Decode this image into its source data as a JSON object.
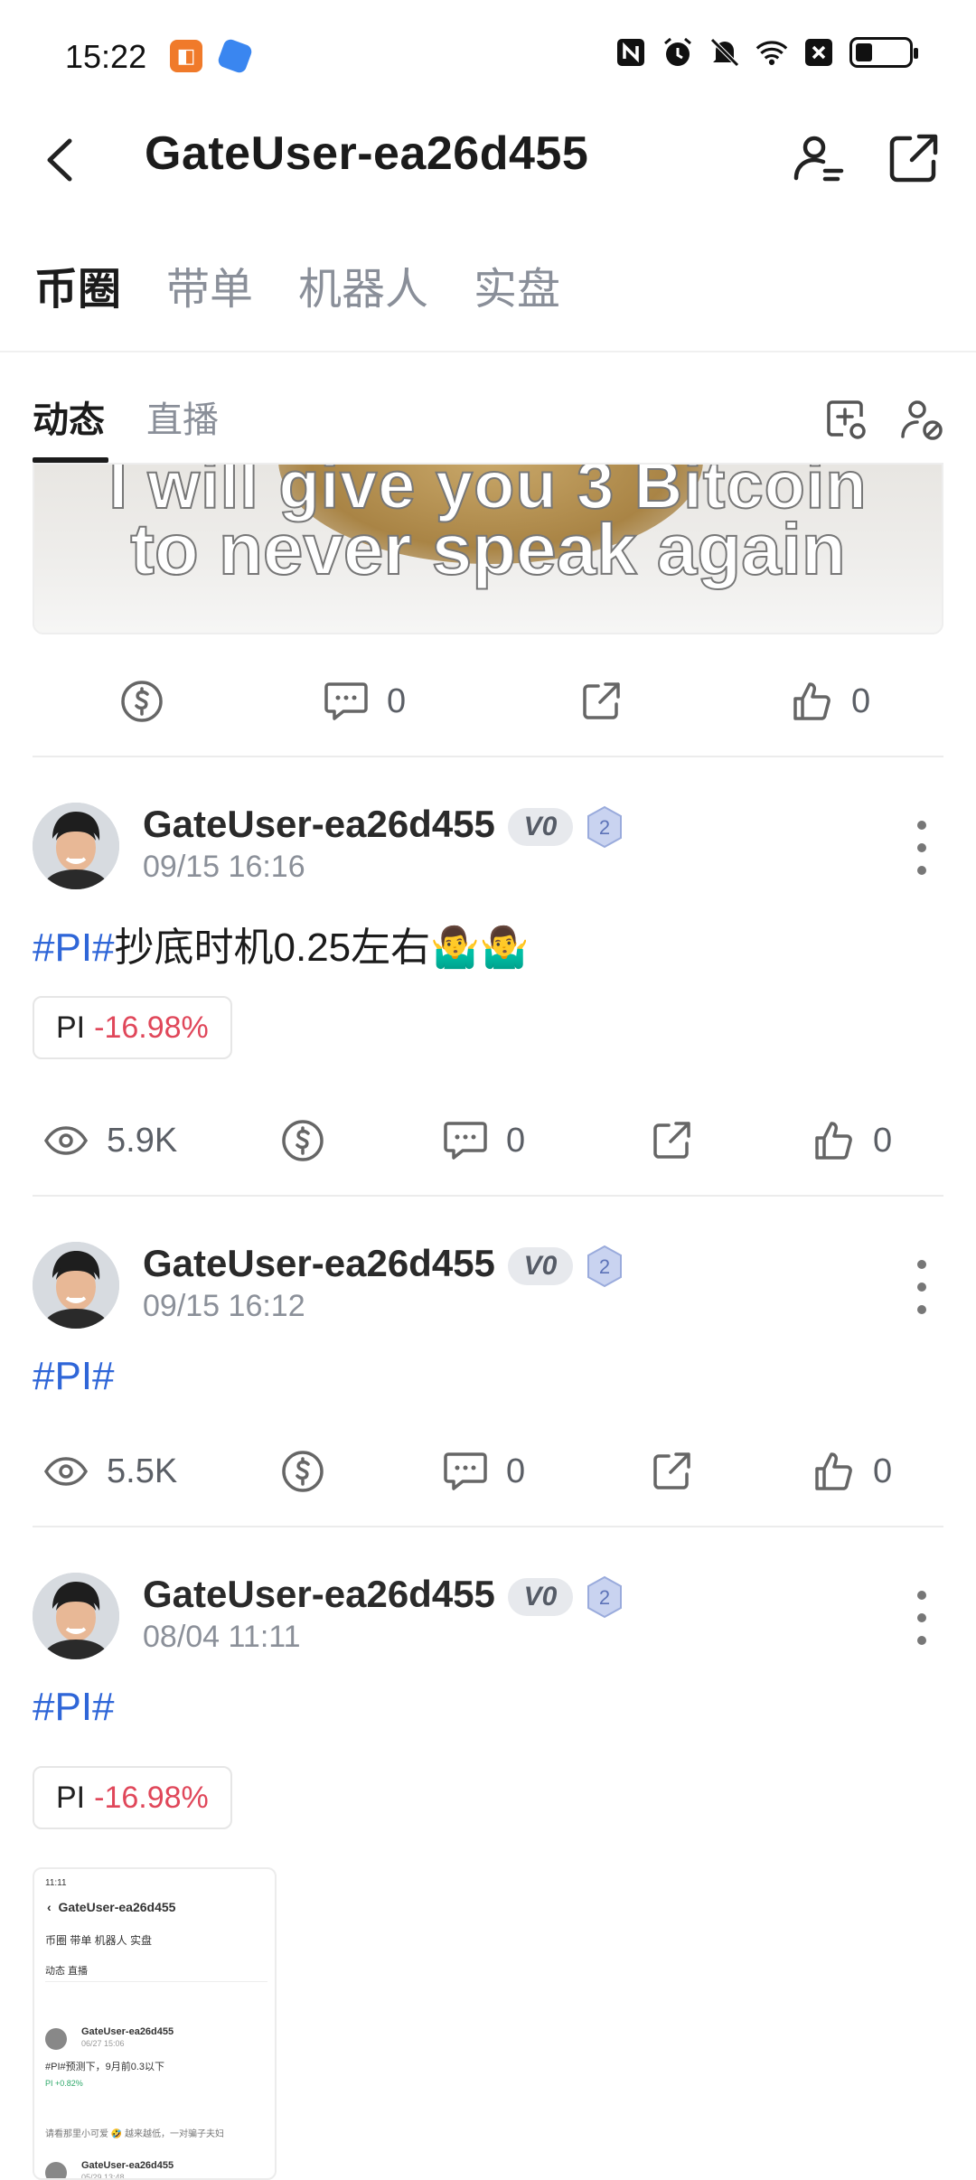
{
  "status_bar": {
    "time": "15:22",
    "icons": [
      "nfc-icon",
      "alarm-icon",
      "mute-icon",
      "wifi-icon",
      "x-notification-icon",
      "battery-icon"
    ]
  },
  "header": {
    "title": "GateUser-ea26d455"
  },
  "main_tabs": [
    "币圈",
    "带单",
    "机器人",
    "实盘"
  ],
  "sub_tabs": [
    "动态",
    "直播"
  ],
  "banner": {
    "line1": "I will give you 3 Bitcoin",
    "line2": "to never speak again"
  },
  "first_actions": {
    "comments": "0",
    "likes": "0"
  },
  "posts": [
    {
      "author": "GateUser-ea26d455",
      "vip": "V0",
      "level": "2",
      "time": "09/15 16:16",
      "hashtag": "#PI#",
      "text": "抄底时机0.25左右🤷‍♂️🤷‍♂️",
      "chip": {
        "coin": "PI",
        "change": "-16.98%"
      },
      "views": "5.9K",
      "comments": "0",
      "likes": "0"
    },
    {
      "author": "GateUser-ea26d455",
      "vip": "V0",
      "level": "2",
      "time": "09/15 16:12",
      "hashtag": "#PI#",
      "text": "",
      "views": "5.5K",
      "comments": "0",
      "likes": "0"
    },
    {
      "author": "GateUser-ea26d455",
      "vip": "V0",
      "level": "2",
      "time": "08/04 11:11",
      "hashtag": "#PI#",
      "text": "",
      "chip": {
        "coin": "PI",
        "change": "-16.98%"
      }
    }
  ],
  "thumbnail": {
    "time": "11:11",
    "title": "GateUser-ea26d455",
    "tabs": "币圈  带单  机器人  实盘",
    "subtabs": "动态  直播",
    "post_author": "GateUser-ea26d455",
    "post_time": "06/27 15:06",
    "post_text": "#PI#预测下，9月前0.3以下",
    "chip": "PI +0.82%",
    "comment_line": "请看那里小可爱 🤣 越来越低，一对骗子夫妇",
    "post2_author": "GateUser-ea26d455",
    "post2_time": "05/29 13:48"
  }
}
